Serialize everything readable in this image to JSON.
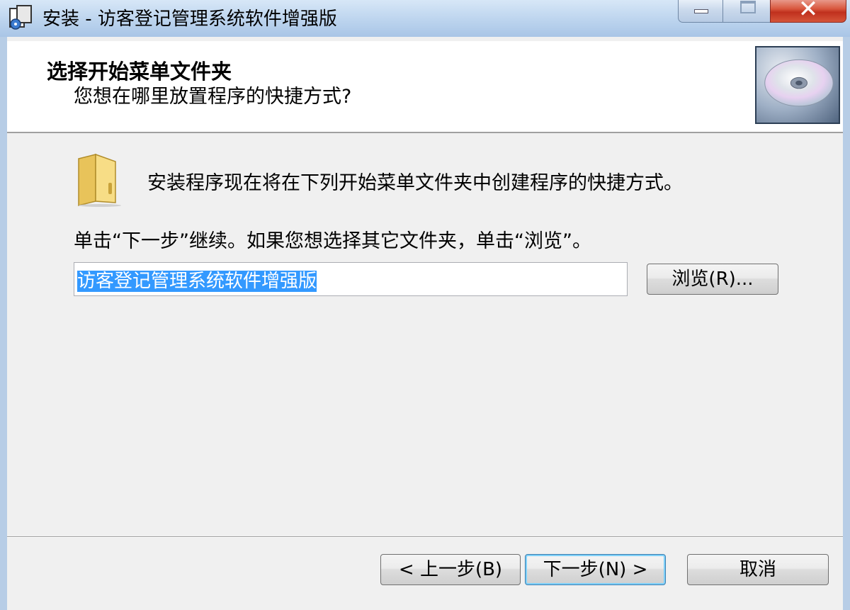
{
  "window": {
    "title": "安装 - 访客登记管理系统软件增强版",
    "close_glyph": "✕"
  },
  "header": {
    "title": "选择开始菜单文件夹",
    "subtitle": "您想在哪里放置程序的快捷方式?"
  },
  "body": {
    "info_text": "安装程序现在将在下列开始菜单文件夹中创建程序的快捷方式。",
    "instruction_text": "单击“下一步”继续。如果您想选择其它文件夹，单击“浏览”。",
    "folder_value": "访客登记管理系统软件增强版",
    "browse_label": "浏览(R)..."
  },
  "footer": {
    "back_label": "< 上一步(B)",
    "next_label": "下一步(N) >",
    "cancel_label": "取消"
  },
  "colors": {
    "selection": "#3399ff",
    "close_button": "#c0301d",
    "dialog_bg": "#f0f0f0"
  }
}
